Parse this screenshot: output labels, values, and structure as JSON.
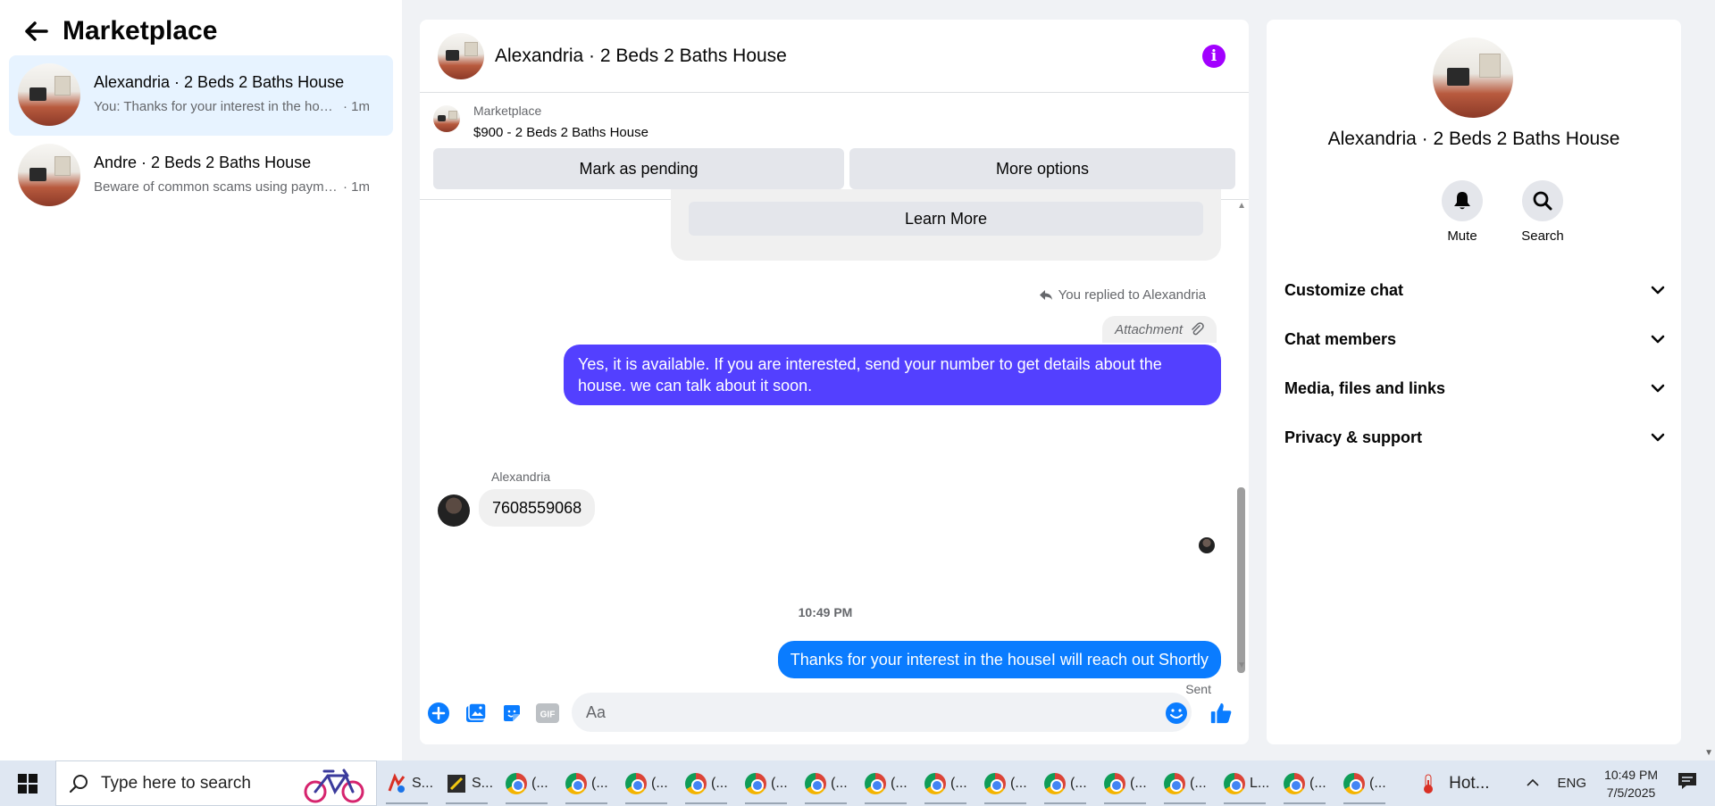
{
  "sidebar": {
    "title": "Marketplace",
    "conversations": [
      {
        "name": "Alexandria · 2 Beds 2 Baths House",
        "snippet": "You: Thanks for your interest in the house...",
        "time": "· 1m"
      },
      {
        "name": "Andre · 2 Beds 2 Baths House",
        "snippet": "Beware of common scams using payment apps",
        "time": "· 1m"
      }
    ]
  },
  "chat": {
    "title": "Alexandria · 2 Beds 2 Baths House",
    "listing": {
      "source": "Marketplace",
      "price_title": "$900 - 2 Beds 2 Baths House",
      "mark_pending": "Mark as pending",
      "more_options": "More options"
    },
    "learn_more": "Learn More",
    "replied_to": "You replied to Alexandria",
    "attachment": "Attachment",
    "outgoing_1": "Yes, it is available. If you are interested, send your number to get details about the house. we can talk about it soon.",
    "sender_name": "Alexandria",
    "incoming_1": "7608559068",
    "timestamp": "10:49 PM",
    "outgoing_2": "Thanks for your interest in the houseI will reach out Shortly",
    "sent_status": "Sent",
    "composer_placeholder": "Aa",
    "gif_label": "GIF"
  },
  "details": {
    "title": "Alexandria · 2 Beds 2 Baths House",
    "mute": "Mute",
    "search": "Search",
    "sections": [
      "Customize chat",
      "Chat members",
      "Media, files and links",
      "Privacy & support"
    ]
  },
  "taskbar": {
    "search_placeholder": "Type here to search",
    "apps": [
      "S...",
      "S...",
      "(...",
      "(...",
      "(...",
      "(...",
      "(...",
      "(...",
      "(...",
      "(...",
      "(...",
      "(...",
      "(...",
      "(...",
      "L...",
      "(...",
      "(..."
    ],
    "weather": "Hot...",
    "language": "ENG",
    "time": "10:49 PM",
    "date": "7/5/2025"
  },
  "colors": {
    "accent_blue": "#0a7cff",
    "outgoing_purple": "#5340ff",
    "info_purple": "#a200ff",
    "active_convo": "#e7f3ff"
  }
}
